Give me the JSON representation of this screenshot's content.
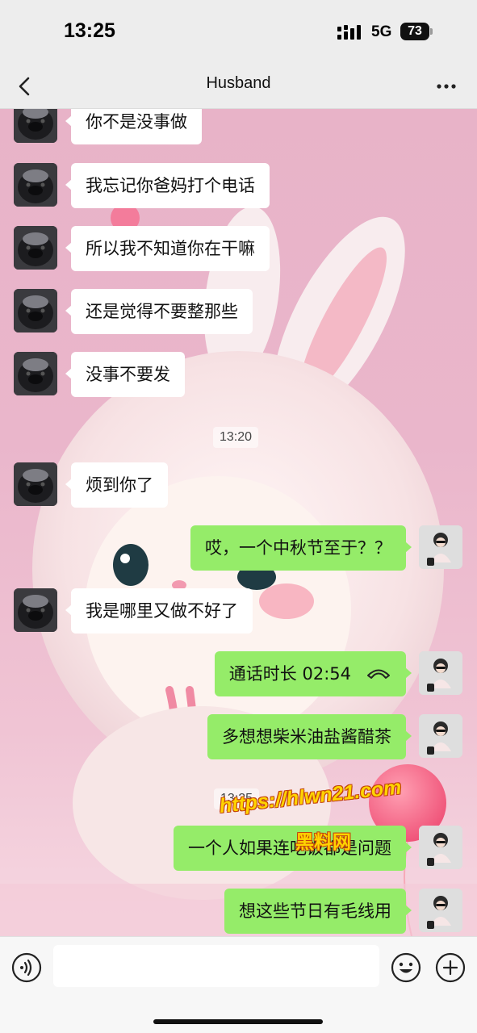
{
  "status_bar": {
    "time": "13:25",
    "network": "5G",
    "battery": "73",
    "signal_icon": "signal-bars-icon"
  },
  "nav": {
    "title": "Husband",
    "back_icon": "chevron-left-icon",
    "more_icon": "more-horizontal-icon"
  },
  "messages": [
    {
      "side": "in",
      "text": "你不是没事做"
    },
    {
      "side": "in",
      "text": "我忘记你爸妈打个电话"
    },
    {
      "side": "in",
      "text": "所以我不知道你在干嘛"
    },
    {
      "side": "in",
      "text": "还是觉得不要整那些"
    },
    {
      "side": "in",
      "text": "没事不要发"
    },
    {
      "type": "time",
      "text": "13:20"
    },
    {
      "side": "in",
      "text": "烦到你了"
    },
    {
      "side": "out",
      "text": "哎，一个中秋节至于？？"
    },
    {
      "side": "in",
      "text": "我是哪里又做不好了"
    },
    {
      "side": "out",
      "text": "通话时长 02:54",
      "icon": "phone-hangup-icon"
    },
    {
      "side": "out",
      "text": "多想想柴米油盐酱醋茶"
    },
    {
      "type": "time",
      "text": "13:25"
    },
    {
      "side": "out",
      "text": "一个人如果连吃饭都是问题"
    },
    {
      "side": "out",
      "text": "想这些节日有毛线用"
    }
  ],
  "watermark": {
    "url": "https://hlwn21.com",
    "label": "黑料网"
  },
  "input_bar": {
    "value": "",
    "voice_icon": "voice-input-icon",
    "emoji_icon": "emoji-icon",
    "plus_icon": "add-circle-icon"
  },
  "colors": {
    "incoming_bubble": "#ffffff",
    "outgoing_bubble": "#95ec69",
    "header_bg": "#ededed",
    "chat_bg": "#eab6cb"
  }
}
